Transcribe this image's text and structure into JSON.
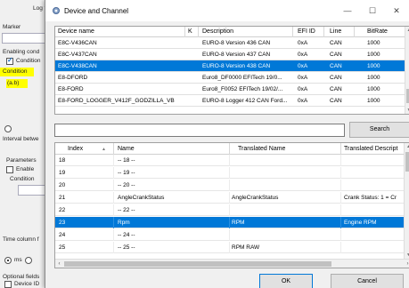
{
  "background_window": {
    "texts": {
      "log_file": "Log file",
      "marker": "Marker",
      "enabling_cond": "Enabling cond",
      "condition_chk": "Condition",
      "condition": "Condition",
      "condition_value": "(a.b)",
      "interval": "Interval betwe",
      "parameters": "Parameters",
      "enable": "Enable",
      "condition2": "Condition",
      "time_column": "Time column f",
      "ms": "ms",
      "optional_fields": "Optional fields",
      "device_id": "Device ID"
    }
  },
  "dialog": {
    "title": "Device and Channel",
    "minimize": "—",
    "maximize": "☐",
    "close": "✕",
    "top_grid": {
      "columns": [
        "Device name",
        "K",
        "Description",
        "EFI ID",
        "Line",
        "BitRate"
      ],
      "rows": [
        {
          "name": "E8C-V436CAN",
          "k": "",
          "desc": "EURO-8 Version 436 CAN",
          "efi": "0xA",
          "line": "CAN",
          "bitrate": "1000",
          "selected": false
        },
        {
          "name": "E8C-V437CAN",
          "k": "",
          "desc": "EURO-8 Version 437 CAN",
          "efi": "0xA",
          "line": "CAN",
          "bitrate": "1000",
          "selected": false
        },
        {
          "name": "E8C-V438CAN",
          "k": "",
          "desc": "EURO-8 Version 438 CAN",
          "efi": "0xA",
          "line": "CAN",
          "bitrate": "1000",
          "selected": true
        },
        {
          "name": "E8-DFORD",
          "k": "",
          "desc": "Euro8_DF0000 EFITech 19/0...",
          "efi": "0xA",
          "line": "CAN",
          "bitrate": "1000",
          "selected": false
        },
        {
          "name": "E8-FORD",
          "k": "",
          "desc": "Euro8_F0052 EFITech 19/02/...",
          "efi": "0xA",
          "line": "CAN",
          "bitrate": "1000",
          "selected": false
        },
        {
          "name": "E8-FORD_LOGGER_V412F_GODZILLA_VB",
          "k": "",
          "desc": "EURO-8 Logger 412 CAN Ford...",
          "efi": "0xA",
          "line": "CAN",
          "bitrate": "1000",
          "selected": false
        }
      ]
    },
    "search": {
      "value": "",
      "button_label": "Search"
    },
    "channel_grid": {
      "columns": [
        "Index",
        "Name",
        "Translated Name",
        "Translated Descript"
      ],
      "rows": [
        {
          "index": "18",
          "name": "-- 18 --",
          "tname": "",
          "tdesc": "",
          "selected": false
        },
        {
          "index": "19",
          "name": "-- 19 --",
          "tname": "",
          "tdesc": "",
          "selected": false
        },
        {
          "index": "20",
          "name": "-- 20 --",
          "tname": "",
          "tdesc": "",
          "selected": false
        },
        {
          "index": "21",
          "name": "AngleCrankStatus",
          "tname": "AngleCrankStatus",
          "tdesc": "Crank Status: 1 = Cr",
          "selected": false
        },
        {
          "index": "22",
          "name": "-- 22 --",
          "tname": "",
          "tdesc": "",
          "selected": false
        },
        {
          "index": "23",
          "name": "Rpm",
          "tname": "RPM",
          "tdesc": "Engine RPM",
          "selected": true
        },
        {
          "index": "24",
          "name": "-- 24 --",
          "tname": "",
          "tdesc": "",
          "selected": false
        },
        {
          "index": "25",
          "name": "-- 25 --",
          "tname": "RPM RAW",
          "tdesc": "",
          "selected": false
        }
      ]
    },
    "buttons": {
      "ok": "OK",
      "cancel": "Cancel"
    }
  },
  "colors": {
    "selection": "#0078d7",
    "highlight": "#ffff00",
    "checkmark": "#1a6dbf"
  }
}
